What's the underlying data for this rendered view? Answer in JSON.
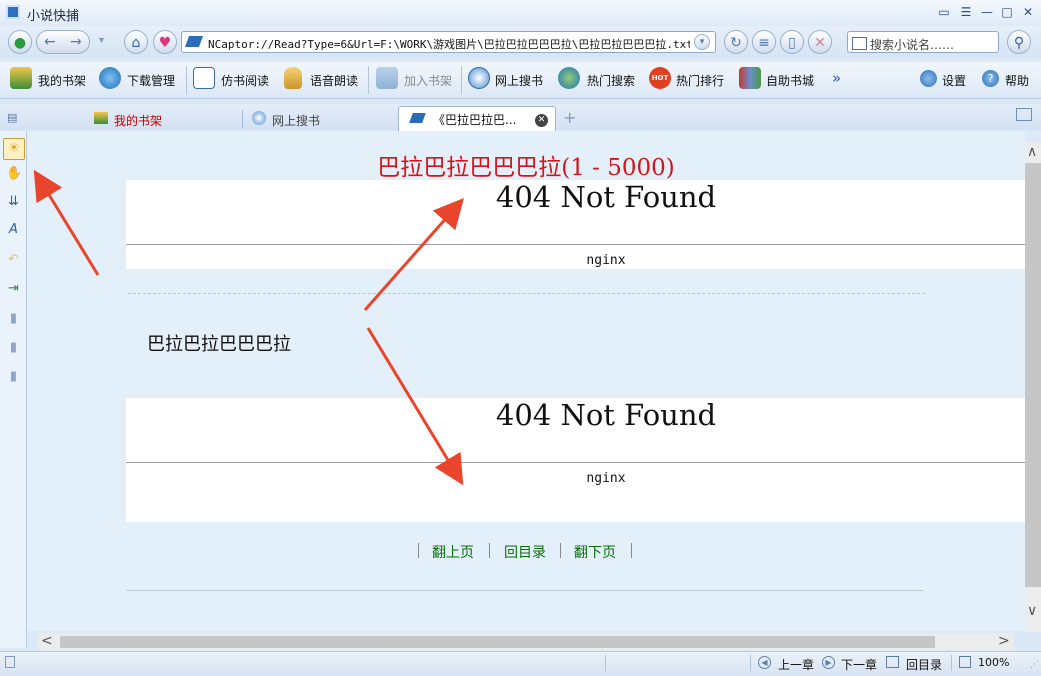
{
  "window": {
    "title": "小说快捕"
  },
  "address": {
    "url": "NCaptor://Read?Type=6&Url=F:\\WORK\\游戏图片\\巴拉巴拉巴巴巴拉\\巴拉巴拉巴巴巴拉.txt",
    "search_placeholder": "搜索小说名……"
  },
  "toolbar": {
    "bookshelf": "我的书架",
    "download": "下载管理",
    "book_read": "仿书阅读",
    "voice": "语音朗读",
    "add_shelf": "加入书架",
    "online_search": "网上搜书",
    "hot_search": "热门搜索",
    "hot_rank": "热门排行",
    "self_store": "自助书城",
    "settings": "设置",
    "help": "帮助"
  },
  "tabs": [
    {
      "label": "我的书架"
    },
    {
      "label": "网上搜书"
    },
    {
      "label": "《巴拉巴拉巴..."
    }
  ],
  "content": {
    "heading": "巴拉巴拉巴巴巴拉(1 - 5000)",
    "error_title": "404 Not Found",
    "error_server": "nginx",
    "body_text": "巴拉巴拉巴巴巴拉",
    "nav": {
      "prev": "翻上页",
      "toc": "回目录",
      "next": "翻下页"
    }
  },
  "statusbar": {
    "prev_chapter": "上一章",
    "next_chapter": "下一章",
    "toc": "回目录",
    "zoom": "100%"
  },
  "colors": {
    "heading": "#d4141a",
    "nav_link": "#0a6d0a",
    "annotation_arrow": "#e8452c"
  }
}
